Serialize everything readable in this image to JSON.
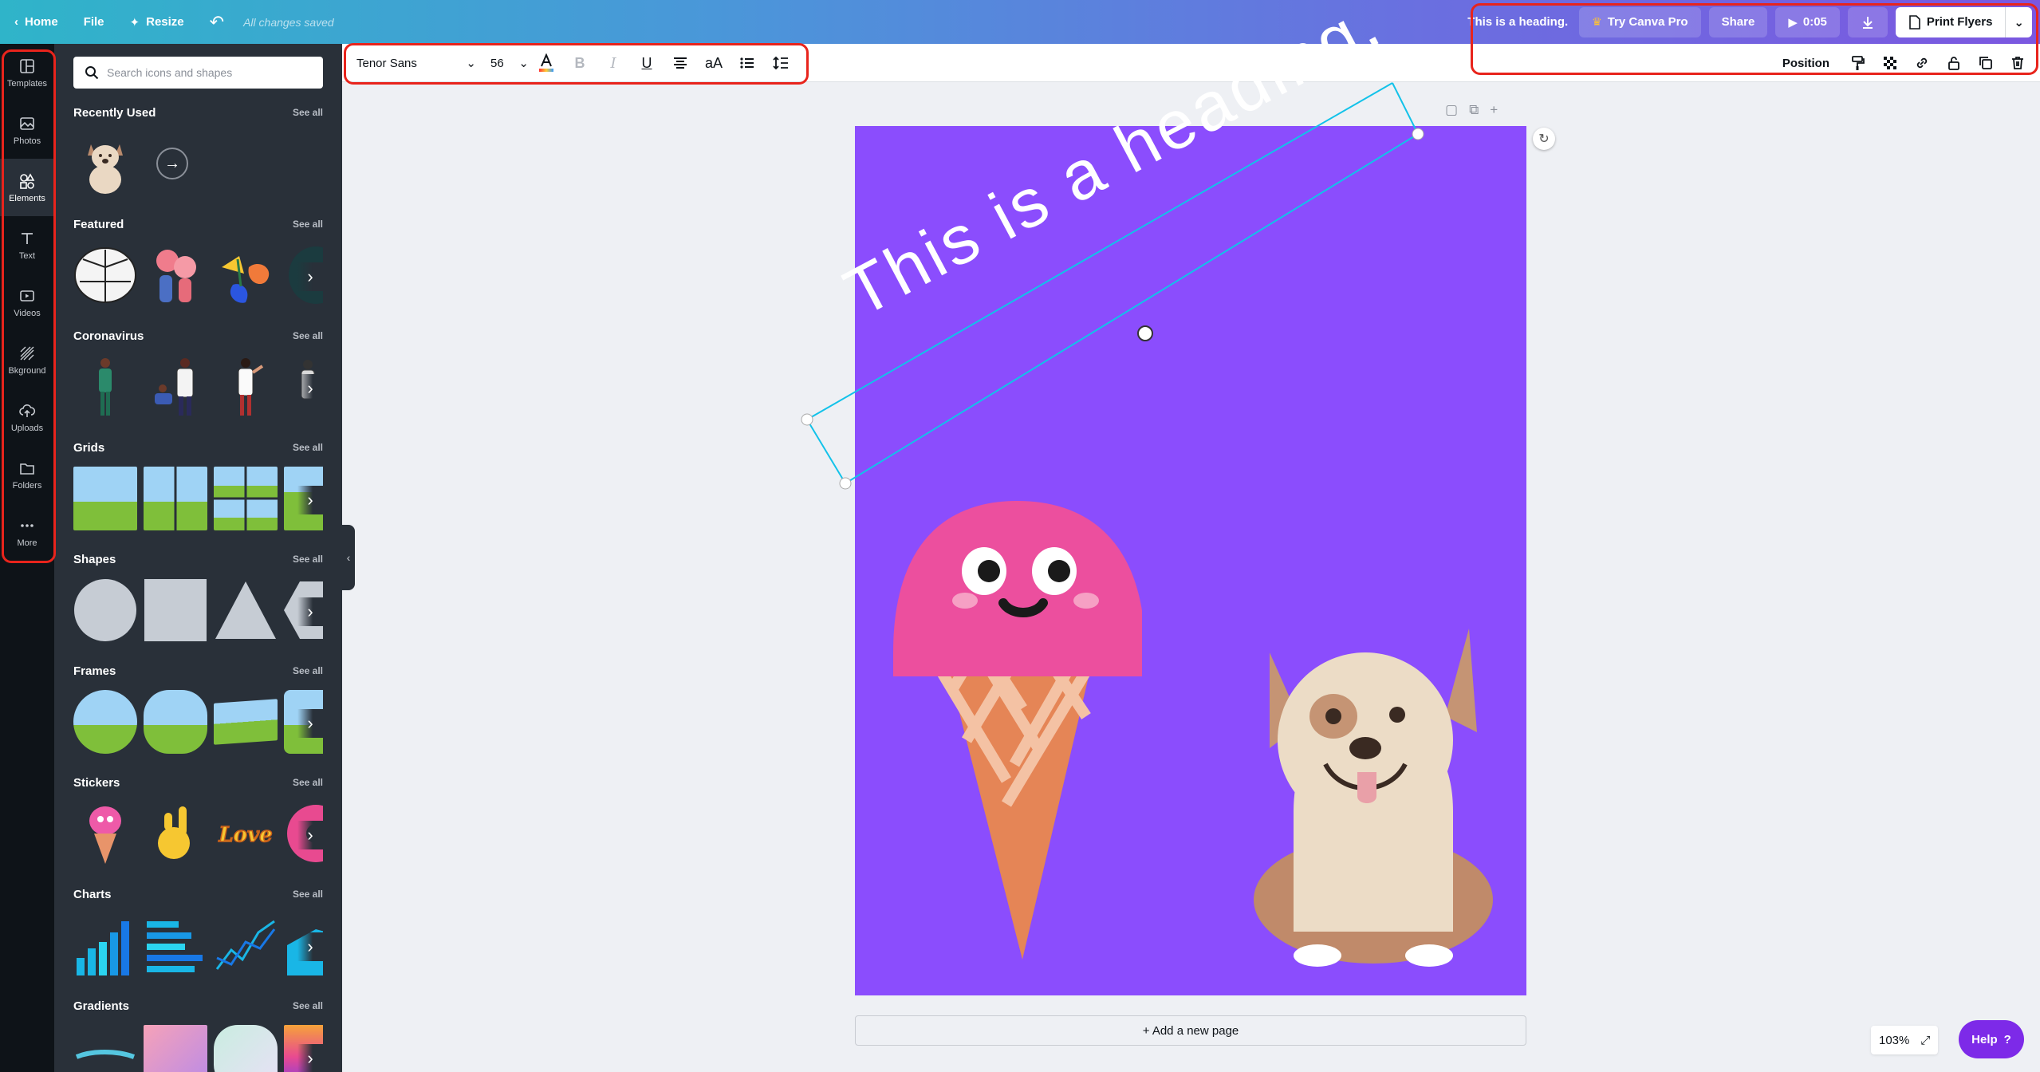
{
  "topbar": {
    "home_label": "Home",
    "file_label": "File",
    "resize_label": "Resize",
    "saved_status": "All changes saved",
    "design_title": "This is a heading.",
    "try_pro_label": "Try Canva Pro",
    "share_label": "Share",
    "play_duration": "0:05",
    "print_label": "Print Flyers"
  },
  "rail": {
    "items": [
      {
        "label": "Templates",
        "icon": "template-icon"
      },
      {
        "label": "Photos",
        "icon": "photo-icon"
      },
      {
        "label": "Elements",
        "icon": "elements-icon",
        "active": true
      },
      {
        "label": "Text",
        "icon": "text-icon"
      },
      {
        "label": "Videos",
        "icon": "video-icon"
      },
      {
        "label": "Bkground",
        "icon": "background-icon"
      },
      {
        "label": "Uploads",
        "icon": "upload-icon"
      },
      {
        "label": "Folders",
        "icon": "folder-icon"
      },
      {
        "label": "More",
        "icon": "more-icon"
      }
    ]
  },
  "panel": {
    "search_placeholder": "Search icons and shapes",
    "see_all": "See all",
    "sections": [
      {
        "title": "Recently Used"
      },
      {
        "title": "Featured"
      },
      {
        "title": "Coronavirus"
      },
      {
        "title": "Grids"
      },
      {
        "title": "Shapes"
      },
      {
        "title": "Frames"
      },
      {
        "title": "Stickers"
      },
      {
        "title": "Charts"
      },
      {
        "title": "Gradients"
      }
    ]
  },
  "textbar": {
    "font_name": "Tenor Sans",
    "font_size": "56",
    "bold": "B",
    "italic": "I",
    "underline": "U",
    "case": "aA",
    "position_label": "Position"
  },
  "canvas": {
    "heading": "This is a heading.",
    "add_page_label": "+ Add a new page",
    "background_color": "#8b4dfd"
  },
  "footer": {
    "zoom": "103%",
    "help_label": "Help",
    "help_mark": "?"
  },
  "colors": {
    "annotation": "#e8241c",
    "selection": "#12c2e9",
    "accent": "#7d2ae8"
  }
}
